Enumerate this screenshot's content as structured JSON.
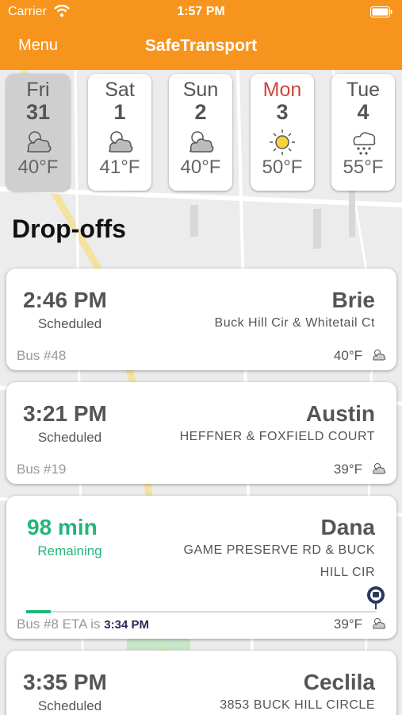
{
  "status_bar": {
    "carrier": "Carrier",
    "time": "1:57 PM"
  },
  "nav": {
    "menu_label": "Menu",
    "title": "SafeTransport"
  },
  "colors": {
    "accent": "#f7941d",
    "green": "#22b57a",
    "red_day": "#d0463a"
  },
  "weather": [
    {
      "day": "Fri",
      "date": "31",
      "icon": "cloudy-icon",
      "temp": "40°F",
      "selected": true
    },
    {
      "day": "Sat",
      "date": "1",
      "icon": "cloudy-icon",
      "temp": "41°F",
      "selected": false
    },
    {
      "day": "Sun",
      "date": "2",
      "icon": "cloudy-icon",
      "temp": "40°F",
      "selected": false
    },
    {
      "day": "Mon",
      "date": "3",
      "icon": "sun-icon",
      "temp": "50°F",
      "selected": false
    },
    {
      "day": "Tue",
      "date": "4",
      "icon": "snow-icon",
      "temp": "55°F",
      "selected": false
    }
  ],
  "section_title": "Drop-offs",
  "dropoffs": [
    {
      "time": "2:46 PM",
      "status": "Scheduled",
      "name": "Brie",
      "address": "Buck Hill Cir & Whitetail Ct",
      "bus": "Bus #48",
      "temp": "40°F",
      "weather_icon": "cloudy-icon"
    },
    {
      "time": "3:21 PM",
      "status": "Scheduled",
      "name": "Austin",
      "address": "HEFFNER & FOXFIELD COURT",
      "bus": "Bus #19",
      "temp": "39°F",
      "weather_icon": "cloudy-icon"
    },
    {
      "time": "98 min",
      "status": "Remaining",
      "name": "Dana",
      "address_line1": "GAME PRESERVE RD & BUCK",
      "address_line2": "HILL CIR",
      "bus_prefix": "Bus #8 ETA",
      "eta_word": "is",
      "eta_time": "3:34 PM",
      "temp": "39°F",
      "weather_icon": "cloudy-icon",
      "progress": 0.07
    },
    {
      "time": "3:35 PM",
      "status": "Scheduled",
      "name": "Ceclila",
      "address": "3853 BUCK HILL CIRCLE"
    }
  ]
}
